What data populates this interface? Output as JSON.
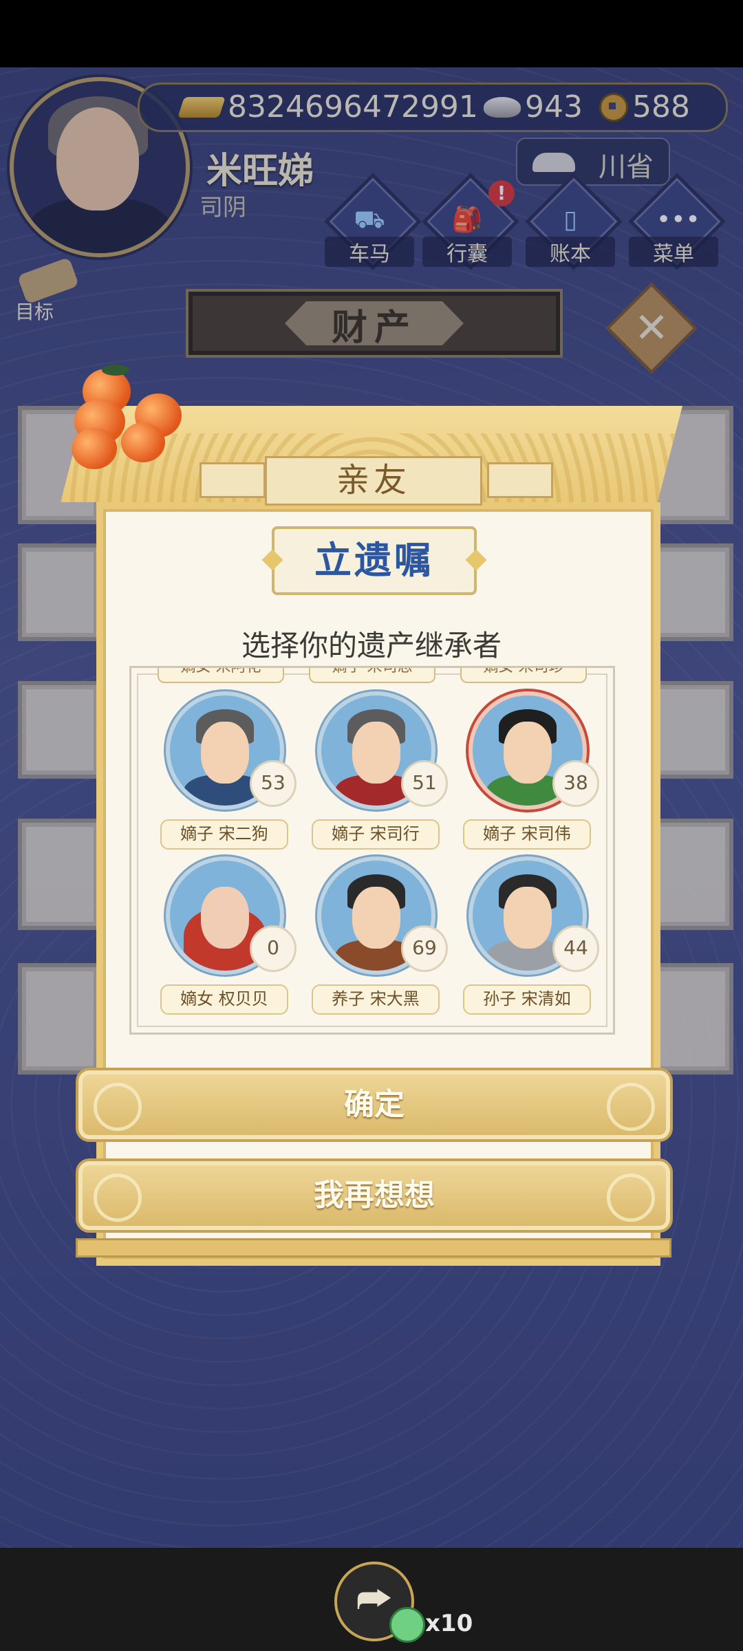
{
  "player": {
    "name": "米旺娣",
    "title": "司阴"
  },
  "resources": {
    "gold": "8324696472991",
    "silver": "943",
    "coins": "588"
  },
  "region": "川省",
  "menu": [
    {
      "label": "车马",
      "icon": "carriage-icon"
    },
    {
      "label": "行囊",
      "icon": "bag-icon",
      "alert": "!"
    },
    {
      "label": "账本",
      "icon": "ledger-icon"
    },
    {
      "label": "菜单",
      "icon": "more-icon",
      "glyph": "•••"
    }
  ],
  "goal_label": "目标",
  "section_title": "财产",
  "close_glyph": "✕",
  "dialog": {
    "tab": "亲友",
    "badge": "立遗嘱",
    "prompt": "选择你的遗产继承者",
    "cut_labels": [
      "嫡女 宋阿花",
      "嫡子 宋司思",
      "嫡女 宋司珍"
    ],
    "heirs": [
      {
        "name": "嫡子 宋二狗",
        "age": "53",
        "robe": "#2f4d7a"
      },
      {
        "name": "嫡子 宋司行",
        "age": "51",
        "robe": "#a4292b"
      },
      {
        "name": "嫡子 宋司伟",
        "age": "38",
        "robe": "#3f8a3e"
      },
      {
        "name": "嫡女 权贝贝",
        "age": "0",
        "robe": "#c0392b"
      },
      {
        "name": "养子 宋大黑",
        "age": "69",
        "robe": "#8a4b2a"
      },
      {
        "name": "孙子 宋清如",
        "age": "44",
        "robe": "#9aa0a6"
      }
    ],
    "confirm": "确定",
    "reconsider": "我再想想"
  },
  "bottom": {
    "share_glyph": "⮫",
    "reward_count": "x10"
  },
  "colors": {
    "accent_gold": "#e8c97a",
    "badge_blue": "#2c56a0",
    "scene_blue": "#4b558e"
  }
}
